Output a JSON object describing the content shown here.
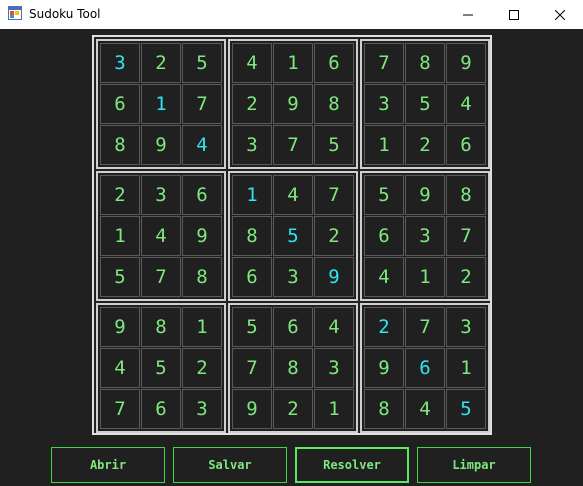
{
  "window": {
    "title": "Sudoku Tool"
  },
  "grid": [
    [
      "3",
      "2",
      "5",
      "4",
      "1",
      "6",
      "7",
      "8",
      "9"
    ],
    [
      "6",
      "1",
      "7",
      "2",
      "9",
      "8",
      "3",
      "5",
      "4"
    ],
    [
      "8",
      "9",
      "4",
      "3",
      "7",
      "5",
      "1",
      "2",
      "6"
    ],
    [
      "2",
      "3",
      "6",
      "1",
      "4",
      "7",
      "5",
      "9",
      "8"
    ],
    [
      "1",
      "4",
      "9",
      "8",
      "5",
      "2",
      "6",
      "3",
      "7"
    ],
    [
      "5",
      "7",
      "8",
      "6",
      "3",
      "9",
      "4",
      "1",
      "2"
    ],
    [
      "9",
      "8",
      "1",
      "5",
      "6",
      "4",
      "2",
      "7",
      "3"
    ],
    [
      "4",
      "5",
      "2",
      "7",
      "8",
      "3",
      "9",
      "6",
      "1"
    ],
    [
      "7",
      "6",
      "3",
      "9",
      "2",
      "1",
      "8",
      "4",
      "5"
    ]
  ],
  "highlighted": [
    [
      0,
      0
    ],
    [
      1,
      1
    ],
    [
      2,
      2
    ],
    [
      3,
      3
    ],
    [
      4,
      4
    ],
    [
      5,
      5
    ],
    [
      6,
      6
    ],
    [
      7,
      7
    ],
    [
      8,
      8
    ]
  ],
  "colors": {
    "solved_digit": "#7ee87e",
    "given_digit": "#2ee6f0",
    "background": "#202020",
    "button_border": "#3fd74a"
  },
  "buttons": {
    "open": "Abrir",
    "save": "Salvar",
    "solve": "Resolver",
    "clear": "Limpar"
  }
}
